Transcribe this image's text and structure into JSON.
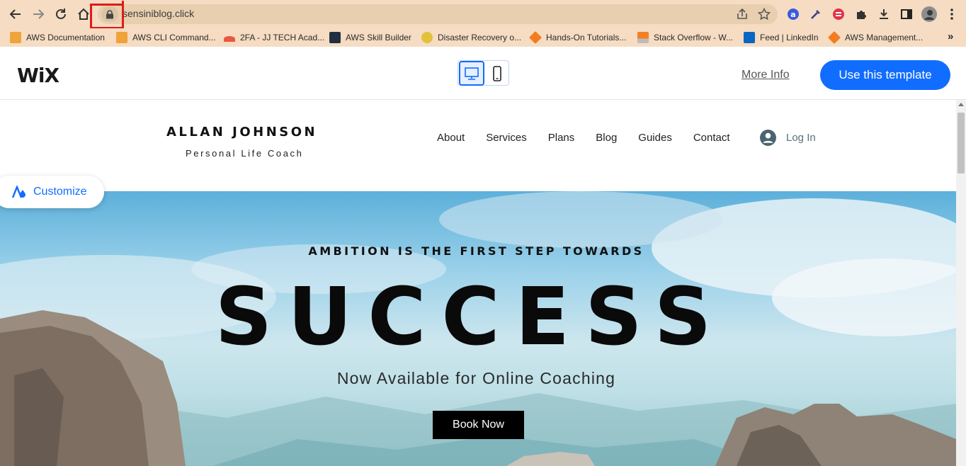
{
  "browser": {
    "url": "sensiniblog.click",
    "bookmarks": [
      {
        "label": "AWS Documentation",
        "icon": "aws-docs-icon",
        "color": "#f0a23b"
      },
      {
        "label": "AWS CLI Command...",
        "icon": "aws-cli-icon",
        "color": "#f0a23b"
      },
      {
        "label": "2FA - JJ TECH Acad...",
        "icon": "jjtech-icon",
        "color": "#e8573f"
      },
      {
        "label": "AWS Skill Builder",
        "icon": "aws-skillbuilder-icon",
        "color": "#232f3e"
      },
      {
        "label": "Disaster Recovery o...",
        "icon": "disaster-recovery-icon",
        "color": "#e3c13b"
      },
      {
        "label": "Hands-On Tutorials...",
        "icon": "hands-on-tutorials-icon",
        "color": "#f27d20"
      },
      {
        "label": "Stack Overflow - W...",
        "icon": "stackoverflow-icon",
        "color": "#f48024"
      },
      {
        "label": "Feed | LinkedIn",
        "icon": "linkedin-icon",
        "color": "#0a66c2"
      },
      {
        "label": "AWS Management...",
        "icon": "aws-management-icon",
        "color": "#f27d20"
      }
    ],
    "overflow": "»"
  },
  "wix": {
    "logo": "WiX",
    "more_info": "More Info",
    "use_template": "Use this template",
    "accent": "#116dff"
  },
  "site": {
    "brand_name": "ALLAN JOHNSON",
    "brand_tagline": "Personal Life Coach",
    "nav": [
      "About",
      "Services",
      "Plans",
      "Blog",
      "Guides",
      "Contact"
    ],
    "login": "Log In",
    "customize": "Customize",
    "hero": {
      "kicker": "AMBITION IS THE FIRST STEP TOWARDS",
      "title": "SUCCESS",
      "subtitle": "Now Available for Online Coaching",
      "cta": "Book Now"
    }
  }
}
